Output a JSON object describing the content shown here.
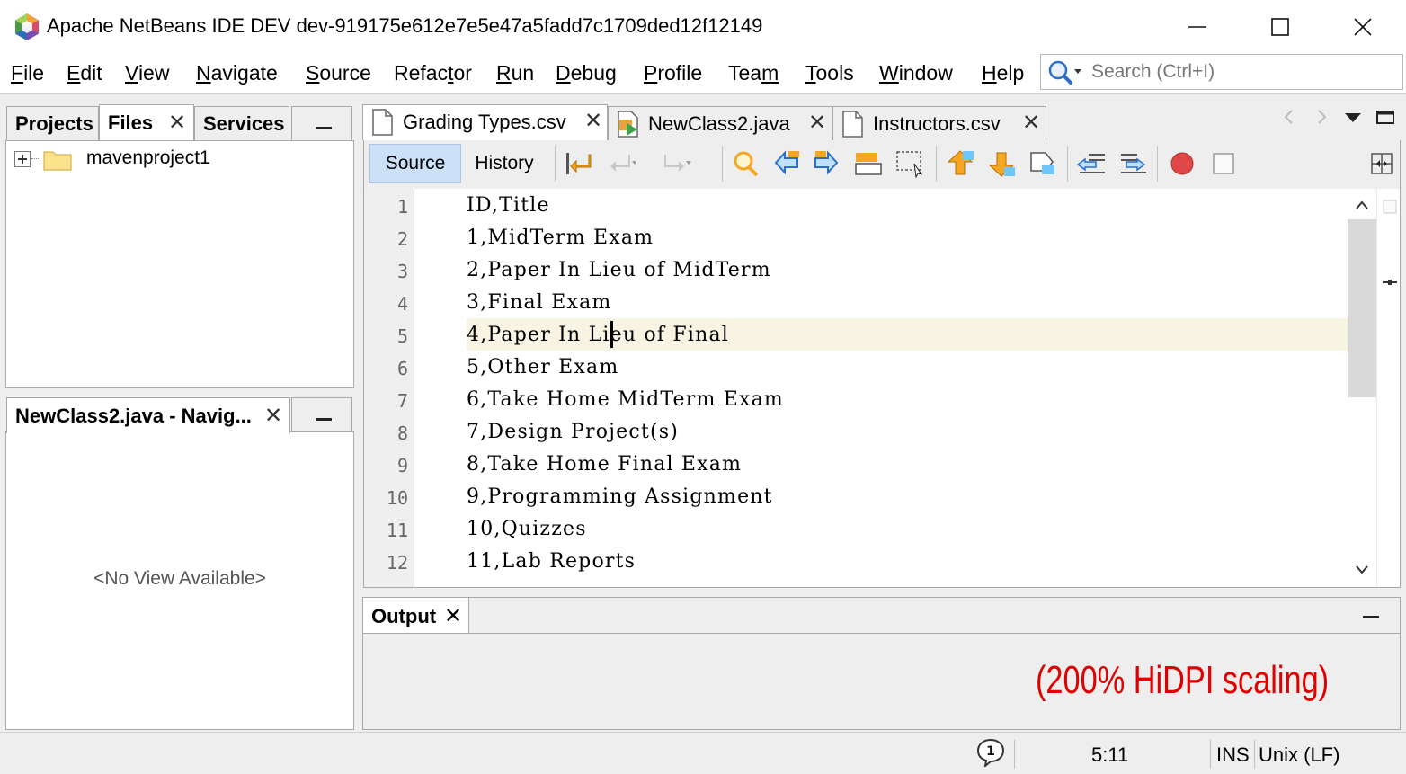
{
  "window": {
    "title": "Apache NetBeans IDE DEV dev-919175e612e7e5e47a5fadd7c1709ded12f12149",
    "controls": {
      "minimize": "—",
      "maximize": "☐",
      "close": "✕"
    }
  },
  "menu": {
    "items": [
      {
        "mn": "F",
        "rest": "ile"
      },
      {
        "mn": "E",
        "rest": "dit"
      },
      {
        "mn": "V",
        "rest": "iew"
      },
      {
        "mn": "N",
        "rest": "avigate"
      },
      {
        "mn": "S",
        "rest": "ource"
      },
      {
        "pre": "Refac",
        "mn": "t",
        "rest": "or"
      },
      {
        "mn": "R",
        "rest": "un"
      },
      {
        "mn": "D",
        "rest": "ebug"
      },
      {
        "mn": "P",
        "rest": "rofile"
      },
      {
        "pre": "Tea",
        "mn": "m",
        "rest": ""
      },
      {
        "mn": "T",
        "rest": "ools"
      },
      {
        "mn": "W",
        "rest": "indow"
      },
      {
        "mn": "H",
        "rest": "elp"
      }
    ],
    "search_placeholder": "Search (Ctrl+I)"
  },
  "left_top": {
    "tabs": [
      "Projects",
      "Files",
      "Services"
    ],
    "active_tab": "Files",
    "tree": [
      {
        "label": "mavenproject1"
      }
    ]
  },
  "left_bottom": {
    "tab": "NewClass2.java - Navig...",
    "empty_text": "<No View Available>"
  },
  "editor": {
    "tabs": [
      "Grading Types.csv",
      "NewClass2.java",
      "Instructors.csv"
    ],
    "active_tab": "Grading Types.csv",
    "view_buttons": {
      "source": "Source",
      "history": "History"
    },
    "lines": [
      {
        "n": "1",
        "text": "ID,Title"
      },
      {
        "n": "2",
        "text": "1,MidTerm Exam"
      },
      {
        "n": "3",
        "text": "2,Paper In Lieu of MidTerm"
      },
      {
        "n": "4",
        "text": "3,Final Exam"
      },
      {
        "n": "5",
        "text": "4,Paper In Lieu of Final"
      },
      {
        "n": "6",
        "text": "5,Other Exam"
      },
      {
        "n": "7",
        "text": "6,Take Home MidTerm Exam"
      },
      {
        "n": "8",
        "text": "7,Design Project(s)"
      },
      {
        "n": "9",
        "text": "8,Take Home Final Exam"
      },
      {
        "n": "10",
        "text": "9,Programming Assignment"
      },
      {
        "n": "11",
        "text": "10,Quizzes"
      },
      {
        "n": "12",
        "text": "11,Lab Reports"
      }
    ]
  },
  "output": {
    "tab": "Output",
    "annotation": "(200% HiDPI scaling)"
  },
  "status": {
    "position": "5:11",
    "insert_mode": "INS",
    "line_endings": "Unix (LF)",
    "notifications": "1"
  },
  "colors": {
    "accent": "#cce1f7",
    "current_line": "#f8f4e4",
    "annotation": "#e00000",
    "record": "#e04848"
  }
}
